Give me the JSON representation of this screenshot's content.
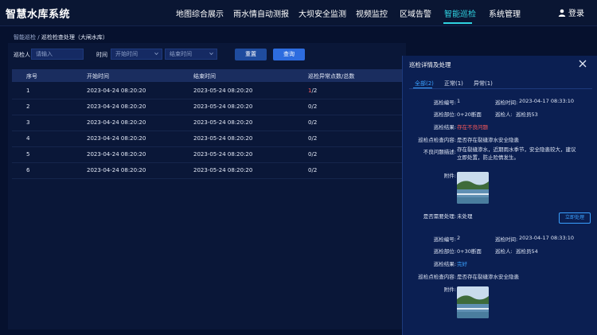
{
  "app": {
    "title": "智慧水库系统"
  },
  "nav": {
    "items": [
      {
        "label": "地图综合展示",
        "active": false
      },
      {
        "label": "雨水情自动测报",
        "active": false
      },
      {
        "label": "大坝安全监测",
        "active": false
      },
      {
        "label": "视频监控",
        "active": false
      },
      {
        "label": "区域告警",
        "active": false
      },
      {
        "label": "智能巡检",
        "active": true
      },
      {
        "label": "系统管理",
        "active": false
      }
    ],
    "login_label": "登录",
    "active_color": "#2fd2e0"
  },
  "breadcrumb": {
    "root": "智能巡检",
    "separator": "/",
    "current": "巡检检查处理（大闸水库）"
  },
  "filters": {
    "inspector_label": "巡检人",
    "inspector_placeholder": "请输入",
    "time_label": "时间",
    "start_placeholder": "开始时间",
    "end_placeholder": "结束时间",
    "reset_label": "重置",
    "query_label": "查询"
  },
  "table": {
    "headers": [
      "序号",
      "开始时间",
      "结束时间",
      "巡检异常点数/总数"
    ],
    "rows": [
      {
        "index": "1",
        "start": "2023-04-24 08:20:20",
        "end": "2023-05-24 08:20:20",
        "abnormal": "1",
        "sep": "/",
        "total": "2"
      },
      {
        "index": "2",
        "start": "2023-04-24 08:20:20",
        "end": "2023-05-24 08:20:20",
        "abnormal": "0",
        "sep": "/",
        "total": "2"
      },
      {
        "index": "3",
        "start": "2023-04-24 08:20:20",
        "end": "2023-05-24 08:20:20",
        "abnormal": "0",
        "sep": "/",
        "total": "2"
      },
      {
        "index": "4",
        "start": "2023-04-24 08:20:20",
        "end": "2023-05-24 08:20:20",
        "abnormal": "0",
        "sep": "/",
        "total": "2"
      },
      {
        "index": "5",
        "start": "2023-04-24 08:20:20",
        "end": "2023-05-24 08:20:20",
        "abnormal": "0",
        "sep": "/",
        "total": "2"
      },
      {
        "index": "6",
        "start": "2023-04-24 08:20:20",
        "end": "2023-05-24 08:20:20",
        "abnormal": "0",
        "sep": "/",
        "total": "2"
      }
    ]
  },
  "detail": {
    "title": "巡检详情及处理",
    "tabs": [
      {
        "label": "全部(2)",
        "active": true
      },
      {
        "label": "正常(1)",
        "active": false
      },
      {
        "label": "异常(1)",
        "active": false
      }
    ],
    "records": [
      {
        "no_label": "巡检编号:",
        "no": "1",
        "time_label": "巡检时间:",
        "time": "2023-04-17 08:33:10",
        "loc_label": "巡检部位:",
        "loc": "0+20断面",
        "person_label": "巡检人:",
        "person": "巡检员53",
        "result_label": "巡检结果:",
        "result": "存在不良问题",
        "content_label": "巡检点检查内容:",
        "content": "是否存在裂缝渗水安全隐患",
        "problem_label": "不良问题描述:",
        "problem": "存在裂缝渗水，近期雨水季节，安全隐患较大，建议立即处置，防止险情发生。",
        "attach_label": "附件:",
        "handle_label": "是否需要处理:",
        "handle": "未处理",
        "action_label": "立即处理"
      },
      {
        "no_label": "巡检编号:",
        "no": "2",
        "time_label": "巡检时间:",
        "time": "2023-04-17 08:33:10",
        "loc_label": "巡检部位:",
        "loc": "0+30断面",
        "person_label": "巡检人:",
        "person": "巡检员54",
        "result_label": "巡检结果:",
        "result": "完好",
        "content_label": "巡检点检查内容:",
        "content": "是否存在裂缝渗水安全隐患",
        "attach_label": "附件:"
      }
    ]
  }
}
